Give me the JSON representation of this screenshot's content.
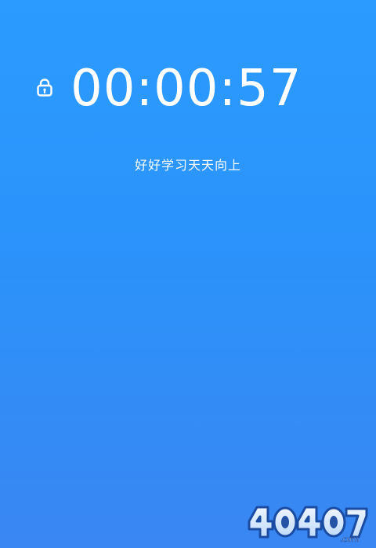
{
  "timer": {
    "lock_icon": "lock-icon",
    "time": "00:00:57"
  },
  "motto": {
    "text": "好好学习天天向上"
  },
  "watermark": {
    "brand": "4O4O7",
    "domain": ".com"
  },
  "colors": {
    "background_top": "#2b9bff",
    "background_bottom": "#3a86f2",
    "text": "#ffffff"
  }
}
